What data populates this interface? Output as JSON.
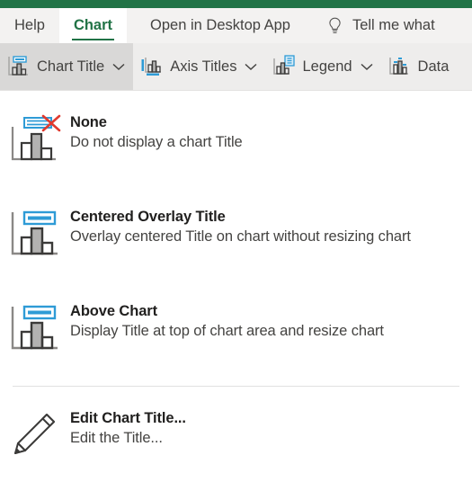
{
  "theme": {
    "brand_green": "#217346",
    "ribbon_bg": "#eeedec",
    "tabbar_bg": "#f3f2f1",
    "pressed_bg": "#d9d8d7",
    "icon_blue": "#2e9bd6",
    "icon_red": "#e03a2f",
    "text_dark": "#201f1e",
    "text_body": "#444341"
  },
  "tabs": [
    {
      "label": "Help",
      "active": false
    },
    {
      "label": "Chart",
      "active": true
    }
  ],
  "quick_commands": [
    {
      "label": "Open in Desktop App",
      "icon": "none"
    },
    {
      "label": "Tell me what",
      "icon": "lightbulb-icon"
    }
  ],
  "ribbon": {
    "buttons": [
      {
        "label": "Chart Title",
        "icon": "chart-title-icon",
        "has_chevron": true,
        "pressed": true
      },
      {
        "label": "Axis Titles",
        "icon": "axis-titles-icon",
        "has_chevron": true,
        "pressed": false
      },
      {
        "label": "Legend",
        "icon": "legend-icon",
        "has_chevron": true,
        "pressed": false
      },
      {
        "label": "Data",
        "icon": "data-labels-icon",
        "has_chevron": false,
        "pressed": false
      }
    ]
  },
  "menu": {
    "items": [
      {
        "title": "None",
        "description": "Do not display a chart Title",
        "icon": "chart-title-none-icon"
      },
      {
        "title": "Centered Overlay Title",
        "description": "Overlay centered Title on chart without resizing chart",
        "icon": "chart-title-centered-overlay-icon"
      },
      {
        "title": "Above Chart",
        "description": "Display Title at top of chart area and resize chart",
        "icon": "chart-title-above-chart-icon"
      },
      {
        "title": "Edit Chart Title...",
        "description": "Edit the Title...",
        "icon": "pencil-icon"
      }
    ]
  }
}
